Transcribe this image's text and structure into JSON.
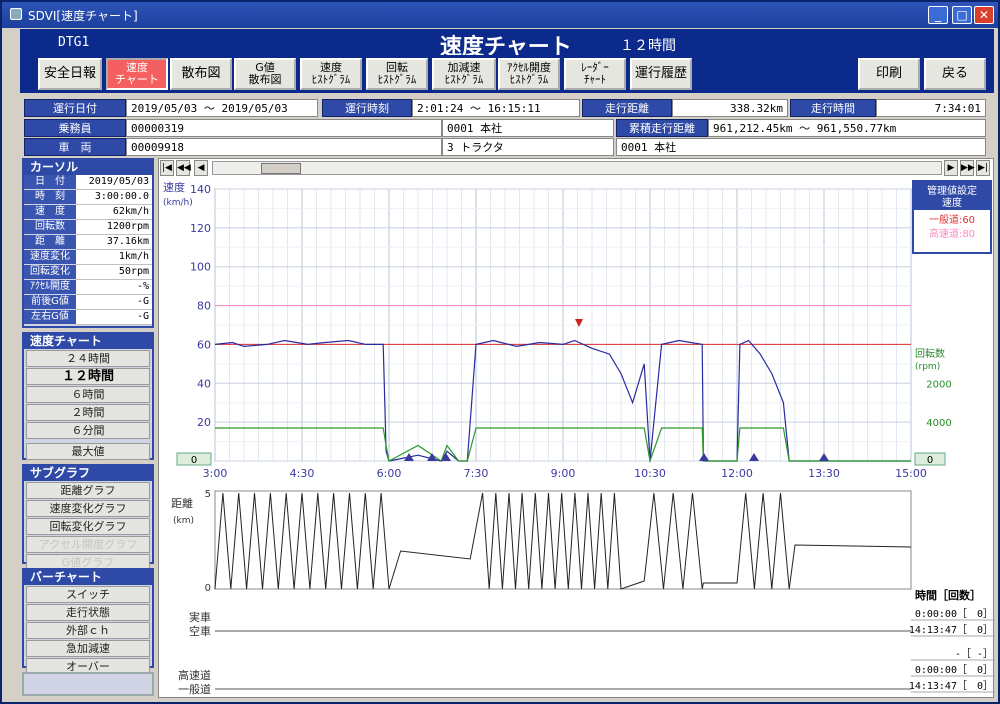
{
  "window": {
    "title": "SDVI[速度チャート]"
  },
  "header": {
    "device": "DTG1",
    "title": "速度チャート",
    "subtitle": "１２時間"
  },
  "toolbar": {
    "buttons": [
      "安全日報",
      "速度\nチャート",
      "散布図",
      "G値\n散布図",
      "速度\nﾋｽﾄｸﾞﾗﾑ",
      "回転\nﾋｽﾄｸﾞﾗﾑ",
      "加減速\nﾋｽﾄｸﾞﾗﾑ",
      "ｱｸｾﾙ開度\nﾋｽﾄｸﾞﾗﾑ",
      "ﾚｰﾀﾞｰ\nﾁｬｰﾄ",
      "運行履歴"
    ],
    "print": "印刷",
    "back": "戻る"
  },
  "info": {
    "date_label": "運行日付",
    "date_value": "2019/05/03 〜 2019/05/03",
    "time_label": "運行時刻",
    "time_value": "2:01:24 〜 16:15:11",
    "dist_label": "走行距離",
    "dist_value": "338.32km",
    "drive_label": "走行時間",
    "drive_value": "7:34:01",
    "crew_label": "乗務員",
    "crew_value": "00000319",
    "crew_office": "0001 本社",
    "total_label": "累積走行距離",
    "total_value": "961,212.45km 〜 961,550.77km",
    "vehicle_label": "車　両",
    "vehicle_value": "00009918",
    "vehicle_type": "3 トラクタ",
    "vehicle_office": "0001 本社"
  },
  "cursor": {
    "title": "カーソル",
    "rows": [
      {
        "label": "日　付",
        "value": "2019/05/03"
      },
      {
        "label": "時　刻",
        "value": "3:00:00.0"
      },
      {
        "label": "速　度",
        "value": "62km/h"
      },
      {
        "label": "回転数",
        "value": "1200rpm"
      },
      {
        "label": "距　離",
        "value": "37.16km"
      },
      {
        "label": "速度変化",
        "value": "1km/h"
      },
      {
        "label": "回転変化",
        "value": "50rpm"
      },
      {
        "label": "ｱｸｾﾙ開度",
        "value": "-%"
      },
      {
        "label": "前後G値",
        "value": "-G"
      },
      {
        "label": "左右G値",
        "value": "-G"
      }
    ]
  },
  "speed_chart_menu": {
    "title": "速度チャート",
    "items": [
      "２４時間",
      "１２時間",
      "６時間",
      "２時間",
      "６分間"
    ],
    "max": "最大値"
  },
  "subgraph_menu": {
    "title": "サブグラフ",
    "items": [
      "距離グラフ",
      "速度変化グラフ",
      "回転変化グラフ",
      "アクセル開度グラフ",
      "G値グラフ"
    ]
  },
  "bar_chart_menu": {
    "title": "バーチャート",
    "items": [
      "スイッチ",
      "走行状態",
      "外部ｃｈ",
      "急加減速",
      "オーバー"
    ]
  },
  "chart_data": [
    {
      "type": "line",
      "ylabel": "速度",
      "yunit": "(km/h)",
      "y2label": "回転数",
      "y2unit": "(rpm)",
      "yticks": [
        0,
        20,
        40,
        60,
        80,
        100,
        120,
        140
      ],
      "y2ticks": [
        2000,
        4000
      ],
      "xticks": [
        "3:00",
        "4:30",
        "6:00",
        "7:30",
        "9:00",
        "10:30",
        "12:00",
        "13:30",
        "15:00"
      ],
      "ylim": [
        0,
        140
      ],
      "xlim": [
        3.0,
        15.0
      ],
      "limits": [
        {
          "name": "一般道",
          "value": 60,
          "color": "#e03030"
        },
        {
          "name": "高速道",
          "value": 80,
          "color": "#ff88c0"
        }
      ],
      "series": [
        {
          "name": "速度",
          "color": "#2a2aa0",
          "x": [
            3.0,
            3.3,
            3.5,
            3.9,
            4.2,
            4.6,
            4.9,
            5.3,
            5.6,
            5.9,
            5.95,
            6.0,
            6.5,
            6.9,
            7.0,
            7.2,
            7.35,
            7.5,
            7.8,
            8.2,
            8.6,
            9.0,
            9.2,
            9.5,
            9.8,
            10.0,
            10.2,
            10.4,
            10.5,
            10.7,
            11.0,
            11.4,
            11.42,
            12.0,
            12.05,
            12.2,
            12.4,
            12.6,
            12.8,
            12.9,
            13.0,
            15.0
          ],
          "y": [
            60,
            61,
            59,
            60,
            62,
            60,
            61,
            62,
            60,
            60,
            5,
            0,
            3,
            0,
            5,
            0,
            0,
            60,
            62,
            59,
            61,
            60,
            62,
            58,
            55,
            45,
            30,
            50,
            0,
            60,
            62,
            60,
            0,
            0,
            60,
            62,
            55,
            45,
            30,
            0,
            0,
            0
          ]
        }
      ]
    },
    {
      "type": "line",
      "ylabel": "距離",
      "yunit": "(km)",
      "yticks": [
        0,
        5
      ]
    }
  ],
  "cursor_panel": {
    "title": "管理値設定",
    "sub": "速度",
    "general": "一般道:60",
    "highway": "高速道:80"
  },
  "bar_labels": {
    "loaded": "実車",
    "empty": "空車",
    "highway": "高速道",
    "general": "一般道"
  },
  "side_values": {
    "speed_zero": "0",
    "rpm_zero": "0"
  },
  "time_panel": {
    "title": "時間［回数］",
    "rows": [
      "0:00:00［　0］",
      "14:13:47［　0］",
      "-［ -］",
      "0:00:00［　0］",
      "14:13:47［　0］"
    ]
  }
}
